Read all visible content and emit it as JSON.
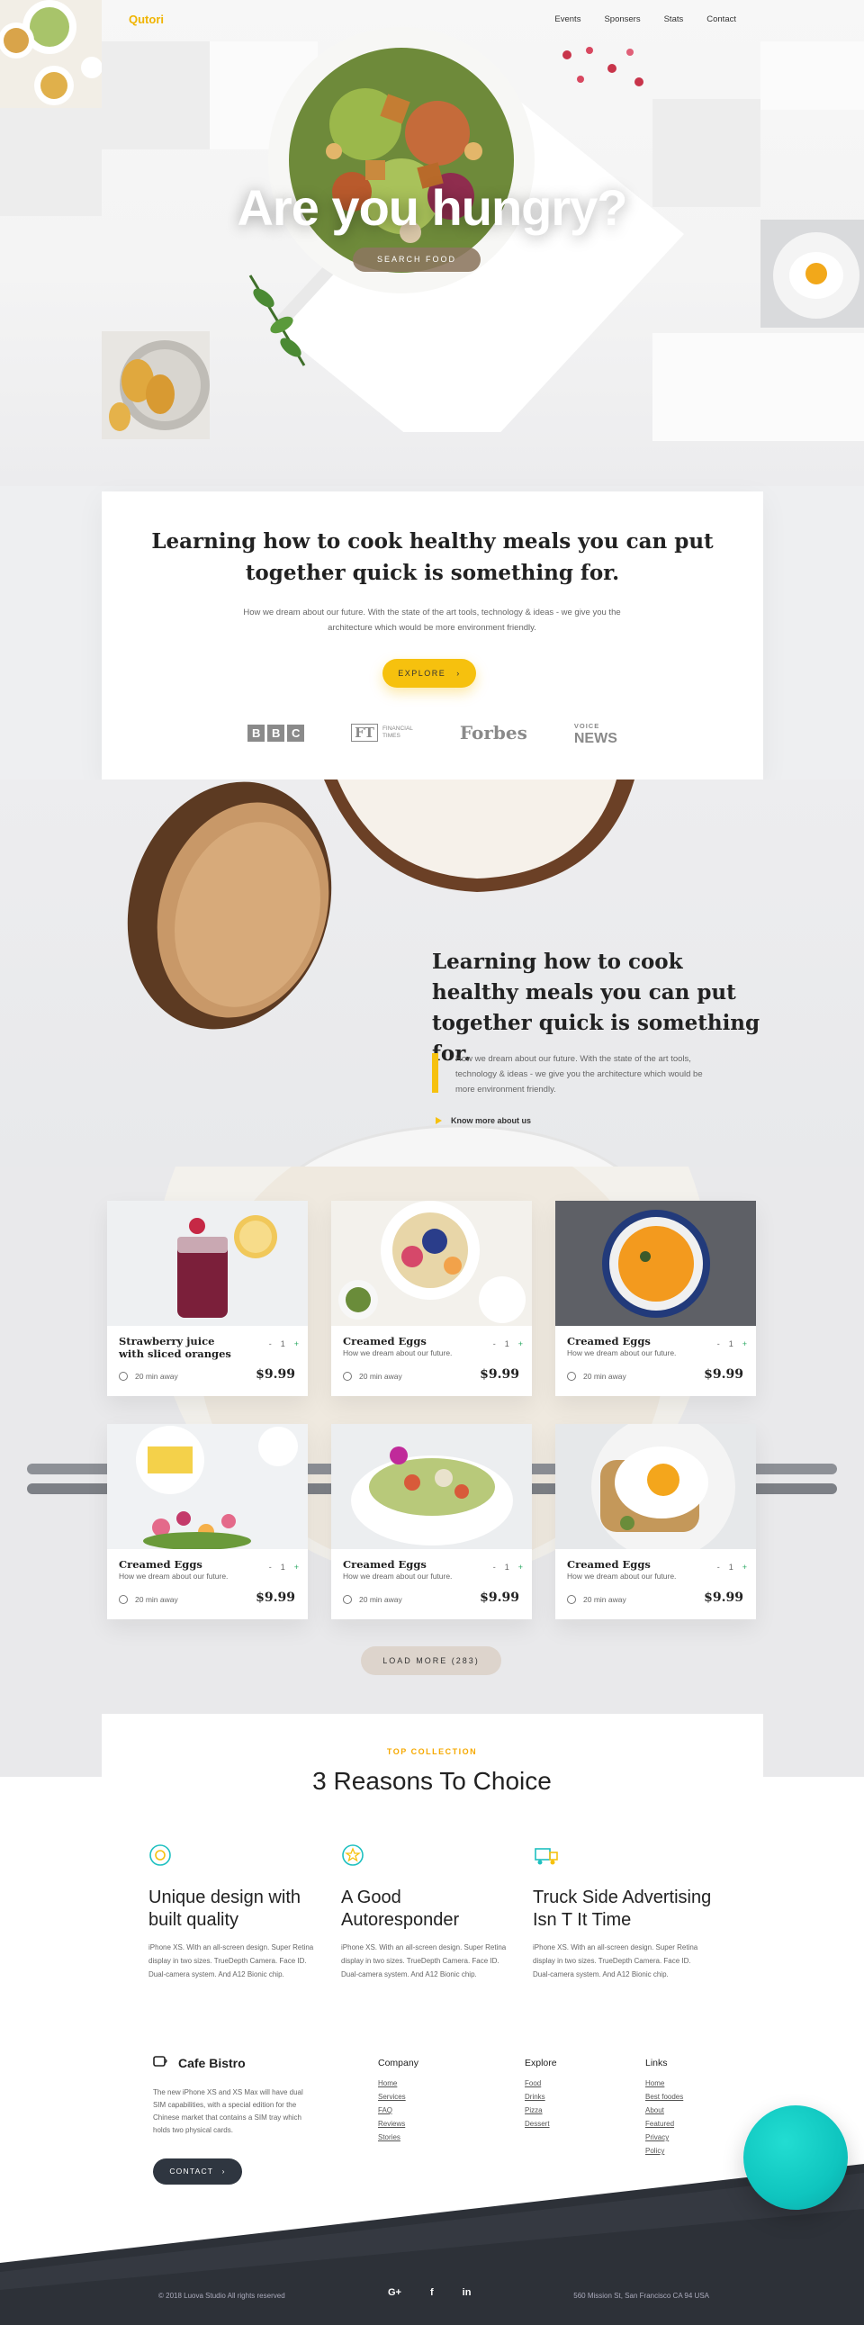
{
  "nav": {
    "logo": "Qutori",
    "links": [
      "Events",
      "Sponsers",
      "Stats",
      "Contact"
    ]
  },
  "hero": {
    "title": "Are you hungry?",
    "button": "SEARCH FOOD"
  },
  "intro": {
    "heading": "Learning how to cook healthy meals you can put together quick is something for.",
    "body": "How we dream about our future. With the state of the art tools, technology & ideas - we give you the architecture which would be more environment friendly.",
    "button": "EXPLORE",
    "brands": {
      "bbc": [
        "B",
        "B",
        "C"
      ],
      "ft_mark": "FT",
      "ft_text_1": "FINANCIAL",
      "ft_text_2": "TIMES",
      "forbes": "Forbes",
      "voice_top": "VOICE",
      "voice_bottom": "NEWS"
    }
  },
  "feature": {
    "heading": "Learning how to cook healthy meals you can put together quick is something for.",
    "body": "How we dream about our future. With the state of the art tools, technology & ideas - we give you the architecture which would be more environment friendly.",
    "link": "Know more about us"
  },
  "products": [
    {
      "title": "Strawberry juice with sliced oranges",
      "desc": "",
      "qty": "1",
      "time": "20 min away",
      "price": "$9.99",
      "image": "strawberry-juice"
    },
    {
      "title": "Creamed Eggs",
      "desc": "How we dream about our future.",
      "qty": "1",
      "time": "20 min away",
      "price": "$9.99",
      "image": "breakfast-plate"
    },
    {
      "title": "Creamed Eggs",
      "desc": "How we dream about our future.",
      "qty": "1",
      "time": "20 min away",
      "price": "$9.99",
      "image": "pumpkin-soup"
    },
    {
      "title": "Creamed Eggs",
      "desc": "How we dream about our future.",
      "qty": "1",
      "time": "20 min away",
      "price": "$9.99",
      "image": "cake-flowers"
    },
    {
      "title": "Creamed Eggs",
      "desc": "How we dream about our future.",
      "qty": "1",
      "time": "20 min away",
      "price": "$9.99",
      "image": "salad-bowl"
    },
    {
      "title": "Creamed Eggs",
      "desc": "How we dream about our future.",
      "qty": "1",
      "time": "20 min away",
      "price": "$9.99",
      "image": "egg-toast"
    }
  ],
  "stepper": {
    "minus": "-",
    "plus": "+"
  },
  "load_more": "LOAD MORE (283)",
  "reasons": {
    "kicker": "TOP COLLECTION",
    "title": "3 Reasons To Choice",
    "items": [
      {
        "title": "Unique design with built quality",
        "body": "iPhone XS. With an all-screen design. Super Retina display in two sizes. TrueDepth Camera. Face ID. Dual-camera system. And A12 Bionic chip.",
        "icon": "chat-icon"
      },
      {
        "title": "A Good Autoresponder",
        "body": "iPhone XS. With an all-screen design. Super Retina display in two sizes. TrueDepth Camera. Face ID. Dual-camera system. And A12 Bionic chip.",
        "icon": "star-icon"
      },
      {
        "title": "Truck Side Advertising Isn T It Time",
        "body": "iPhone XS. With an all-screen design. Super Retina display in two sizes. TrueDepth Camera. Face ID. Dual-camera system. And A12 Bionic chip.",
        "icon": "truck-icon"
      }
    ]
  },
  "footer": {
    "brand": "Cafe Bistro",
    "about": "The new iPhone XS and XS Max will have dual SIM capabilities, with a special edition for the Chinese market that contains a SIM tray which holds two physical cards.",
    "contact": "CONTACT",
    "columns": [
      {
        "title": "Company",
        "links": [
          "Home",
          "Services",
          "FAQ",
          "Reviews",
          "Stories"
        ]
      },
      {
        "title": "Explore",
        "links": [
          "Food",
          "Drinks",
          "Pizza",
          "Dessert"
        ]
      },
      {
        "title": "Links",
        "links": [
          "Home",
          "Best foodes",
          "About",
          "Featured",
          "Privacy",
          "Policy"
        ]
      }
    ],
    "copyright": "© 2018 Luova Studio All rights reserved",
    "social": [
      "G+",
      "f",
      "in"
    ],
    "address": "560 Mission St, San Francisco CA 94 USA"
  },
  "colors": {
    "accent": "#f6c10e",
    "brand": "#f0b400",
    "dark": "#2d3138",
    "teal": "#0fc5bf"
  }
}
